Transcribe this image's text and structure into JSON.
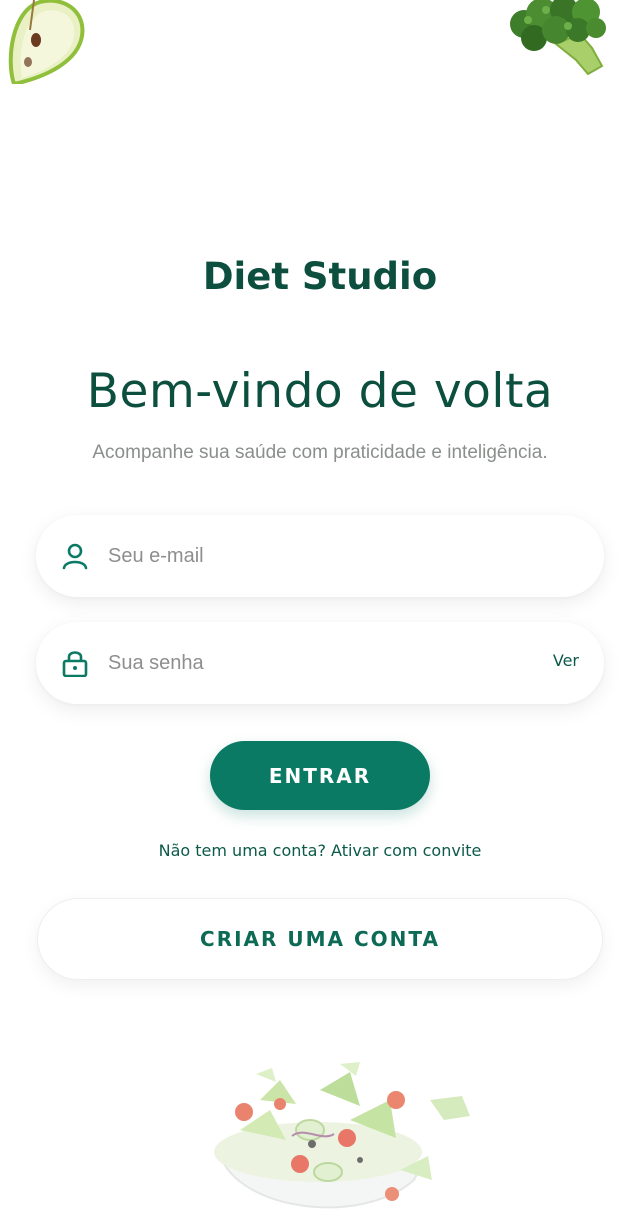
{
  "brand": {
    "name": "Diet Studio"
  },
  "hero": {
    "title": "Bem-vindo de volta",
    "subtitle": "Acompanhe sua saúde com praticidade e inteligência."
  },
  "form": {
    "email": {
      "placeholder": "Seu e-mail",
      "value": "",
      "icon": "user-icon"
    },
    "password": {
      "placeholder": "Sua senha",
      "value": "",
      "icon": "lock-icon",
      "toggle_label": "Ver"
    },
    "submit_label": "ENTRAR"
  },
  "invite_link": "Não tem uma conta? Ativar com convite",
  "create_account_label": "CRIAR UMA CONTA",
  "colors": {
    "primary": "#0b7a64",
    "dark_green": "#0c4f3f",
    "muted_text": "#8a8f8c",
    "background": "#ffffff"
  },
  "decorations": [
    "apple-slice-illustration",
    "broccoli-illustration",
    "salad-bowl-illustration"
  ]
}
